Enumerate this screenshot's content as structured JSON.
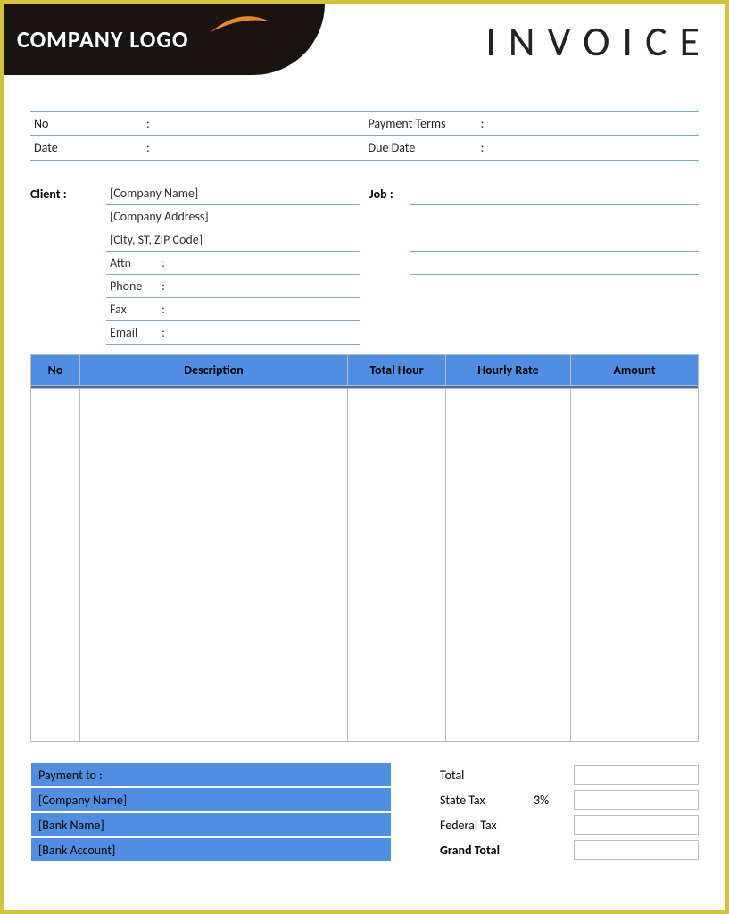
{
  "header": {
    "logo_text": "COMPANY LOGO",
    "title": "INVOICE"
  },
  "meta": {
    "no_label": "No",
    "date_label": "Date",
    "payment_terms_label": "Payment  Terms",
    "due_date_label": "Due Date",
    "colon": ":"
  },
  "client": {
    "section_label": "Client  :",
    "company_name": "[Company Name]",
    "company_address": "[Company Address]",
    "city_zip": "[City, ST, ZIP Code]",
    "attn_label": "Attn",
    "phone_label": "Phone",
    "fax_label": "Fax",
    "email_label": "Email",
    "colon": ":"
  },
  "job": {
    "label": "Job  :",
    "colon": ""
  },
  "table": {
    "headers": {
      "no": "No",
      "description": "Description",
      "total_hour": "Total Hour",
      "hourly_rate": "Hourly Rate",
      "amount": "Amount"
    }
  },
  "payment": {
    "title": "Payment to :",
    "company_name": "[Company Name]",
    "bank_name": "[Bank Name]",
    "bank_account": "[Bank Account]"
  },
  "totals": {
    "total_label": "Total",
    "state_tax_label": "State Tax",
    "state_tax_pct": "3%",
    "federal_tax_label": "Federal Tax",
    "grand_total_label": "Grand Total"
  }
}
